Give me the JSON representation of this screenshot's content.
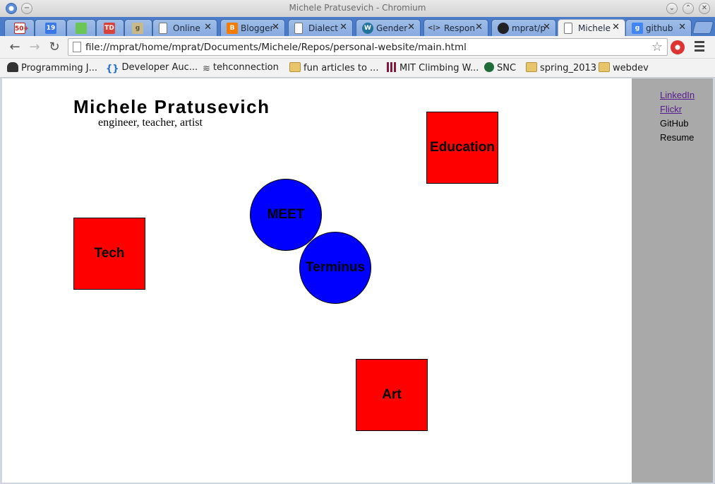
{
  "window": {
    "title": "Michele Pratusevich - Chromium"
  },
  "tabs": [
    {
      "label": "",
      "icon": "gmail-icon",
      "badge": "50+",
      "color": "#c5221f"
    },
    {
      "label": "",
      "icon": "calendar-icon",
      "badge": "19",
      "color": "#3b78e7"
    },
    {
      "label": "",
      "icon": "feedly-icon",
      "badge": "",
      "color": "#6cc655"
    },
    {
      "label": "",
      "icon": "todoist-icon",
      "badge": "TD",
      "color": "#d9433b"
    },
    {
      "label": "",
      "icon": "goodreads-icon",
      "badge": "g",
      "color": "#c9b98a"
    },
    {
      "label": "Online",
      "icon": "page-icon",
      "badge": "",
      "color": "#ffffff"
    },
    {
      "label": "Blogger",
      "icon": "blogger-icon",
      "badge": "B",
      "color": "#f57c00"
    },
    {
      "label": "Dialect",
      "icon": "page-icon",
      "badge": "",
      "color": "#ffffff"
    },
    {
      "label": "Gender",
      "icon": "wordpress-icon",
      "badge": "W",
      "color": "#21759b"
    },
    {
      "label": "Respon",
      "icon": "code-icon",
      "badge": "<|>",
      "color": "#555555"
    },
    {
      "label": "mprat/p",
      "icon": "github-icon",
      "badge": "",
      "color": "#222222"
    },
    {
      "label": "Michele",
      "icon": "page-icon",
      "badge": "",
      "color": "#ffffff",
      "active": true
    },
    {
      "label": "github",
      "icon": "google-icon",
      "badge": "g",
      "color": "#4285f4"
    }
  ],
  "toolbar": {
    "url": "file://mprat/home/mprat/Documents/Michele/Repos/personal-website/main.html"
  },
  "bookmarks": [
    {
      "label": "Programming J...",
      "icon": "spy-icon"
    },
    {
      "label": "Developer Auc...",
      "icon": "braces-icon"
    },
    {
      "label": "tehconnection",
      "icon": "wifi-icon"
    },
    {
      "label": "fun articles to ...",
      "icon": "folder-icon"
    },
    {
      "label": "MIT Climbing W...",
      "icon": "mit-icon"
    },
    {
      "label": "SNC",
      "icon": "snc-icon"
    },
    {
      "label": "spring_2013",
      "icon": "folder-icon"
    },
    {
      "label": "webdev",
      "icon": "folder-icon"
    }
  ],
  "page": {
    "name": "Michele Pratusevich",
    "tagline": "engineer, teacher, artist",
    "shapes": {
      "education": "Education",
      "tech": "Tech",
      "meet": "MEET",
      "terminus": "Terminus",
      "art": "Art"
    },
    "sidebar_links": {
      "linkedin": "LinkedIn",
      "flickr": "Flickr",
      "github": "GitHub",
      "resume": "Resume"
    }
  },
  "colors": {
    "square": "#ff0000",
    "circle": "#0000ff",
    "sidebar": "#a9a9a9",
    "tabstrip": "#4a7cc9"
  }
}
